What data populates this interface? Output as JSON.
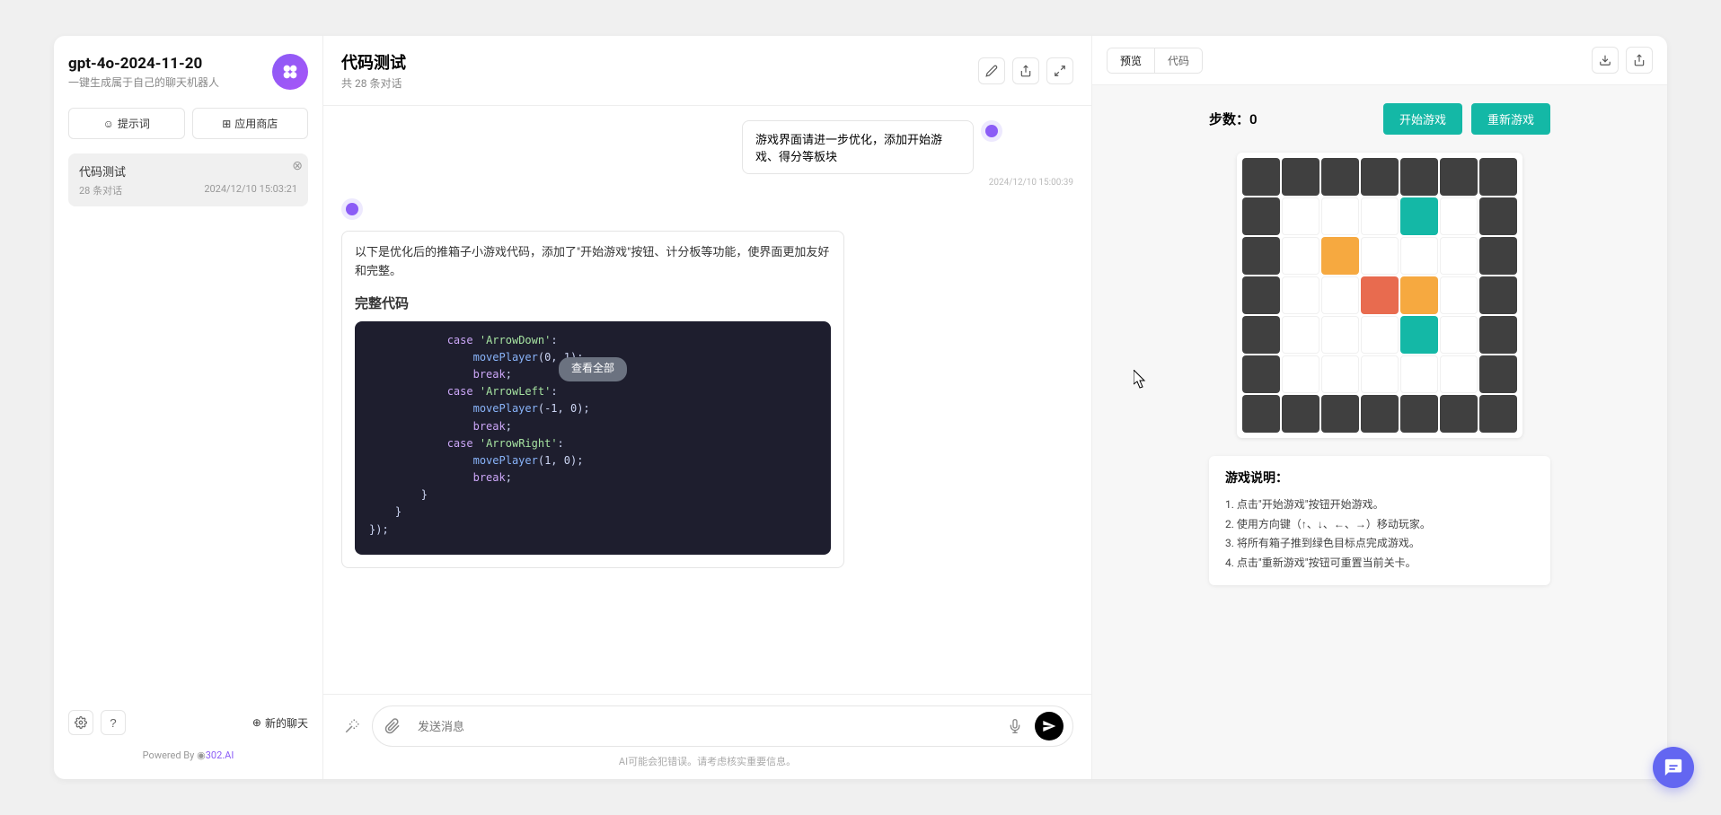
{
  "sidebar": {
    "title": "gpt-4o-2024-11-20",
    "subtitle": "一键生成属于自己的聊天机器人",
    "prompt_btn": "提示词",
    "store_btn": "应用商店",
    "conversation": {
      "title": "代码测试",
      "count": "28 条对话",
      "timestamp": "2024/12/10 15:03:21"
    },
    "new_chat": "新的聊天",
    "powered_prefix": "Powered By ",
    "powered_brand": "302.AI"
  },
  "chat": {
    "title": "代码测试",
    "subtitle": "共 28 条对话",
    "user_msg": "游戏界面请进一步优化，添加开始游戏、得分等板块",
    "user_time": "2024/12/10 15:00:39",
    "assistant_intro": "以下是优化后的推箱子小游戏代码，添加了\"开始游戏\"按钮、计分板等功能，使界面更加友好和完整。",
    "code_heading": "完整代码",
    "view_all": "查看全部",
    "input_placeholder": "发送消息",
    "disclaimer": "AI可能会犯错误。请考虑核实重要信息。"
  },
  "preview": {
    "tab_preview": "预览",
    "tab_code": "代码"
  },
  "game": {
    "steps_label": "步数：",
    "steps_value": "0",
    "start_btn": "开始游戏",
    "restart_btn": "重新游戏",
    "instructions_title": "游戏说明：",
    "inst1": "点击\"开始游戏\"按钮开始游戏。",
    "inst2": "使用方向键（↑、↓、←、→）移动玩家。",
    "inst3": "将所有箱子推到绿色目标点完成游戏。",
    "inst4": "点击\"重新游戏\"按钮可重置当前关卡。"
  },
  "chart_data": {
    "type": "grid",
    "rows": 7,
    "cols": 7,
    "legend": {
      "wall": "#404040",
      "floor": "#ffffff",
      "target": "#14b8a6",
      "box": "#f6a940",
      "player": "#e86b4f"
    },
    "cells": [
      [
        "wall",
        "wall",
        "wall",
        "wall",
        "wall",
        "wall",
        "wall"
      ],
      [
        "wall",
        "floor",
        "floor",
        "floor",
        "target",
        "floor",
        "wall"
      ],
      [
        "wall",
        "floor",
        "box",
        "floor",
        "floor",
        "floor",
        "wall"
      ],
      [
        "wall",
        "floor",
        "floor",
        "player",
        "box",
        "floor",
        "wall"
      ],
      [
        "wall",
        "floor",
        "floor",
        "floor",
        "target",
        "floor",
        "wall"
      ],
      [
        "wall",
        "floor",
        "floor",
        "floor",
        "floor",
        "floor",
        "wall"
      ],
      [
        "wall",
        "wall",
        "wall",
        "wall",
        "wall",
        "wall",
        "wall"
      ]
    ]
  }
}
